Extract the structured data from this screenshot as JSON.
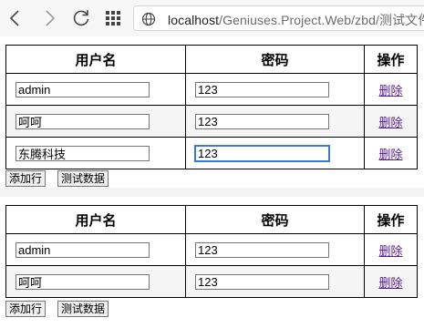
{
  "browser": {
    "url_host": "localhost",
    "url_path": "/Geniuses.Project.Web/zbd/测试文件",
    "icons": [
      "back-icon",
      "forward-icon",
      "reload-icon",
      "apps-grid-icon",
      "globe-icon"
    ]
  },
  "table1": {
    "headers": {
      "username": "用户名",
      "password": "密码",
      "action": "操作"
    },
    "rows": [
      {
        "username": "admin",
        "password": "123",
        "delete": "删除"
      },
      {
        "username": "呵呵",
        "password": "123",
        "delete": "删除"
      },
      {
        "username": "东腾科技",
        "password": "123",
        "delete": "删除"
      }
    ],
    "add_button": "添加行",
    "test_button": "测试数据"
  },
  "table2": {
    "headers": {
      "username": "用户名",
      "password": "密码",
      "action": "操作"
    },
    "rows": [
      {
        "username": "admin",
        "password": "123",
        "delete": "删除"
      },
      {
        "username": "呵呵",
        "password": "123",
        "delete": "删除"
      }
    ],
    "add_button": "添加行",
    "test_button": "测试数据"
  },
  "colors": {
    "focus_border": "#3b78d8",
    "visited_link": "#551a8b"
  }
}
